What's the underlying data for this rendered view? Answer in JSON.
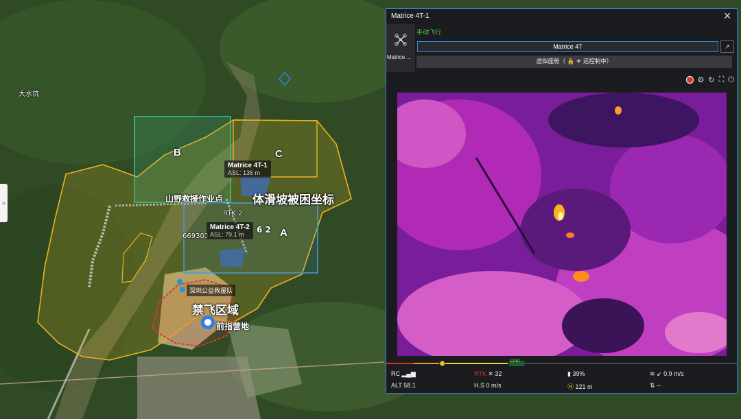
{
  "map": {
    "place_label": "大水坑",
    "zone_labels": {
      "a": "A",
      "b": "B",
      "c": "C"
    },
    "labels": {
      "rescue_area": "山野救援作业点",
      "landslide": "体滑坡被困坐标",
      "no_fly_zone": "禁飞区域",
      "forward_camp": "前指营地",
      "team": "深圳公益救援队",
      "coord_fragment": "669303",
      "rtk_fragment": "RTK 2",
      "num_fragment": "6 2"
    },
    "drones": [
      {
        "name": "Matrice 4T-1",
        "asl": "ASL: 136 m"
      },
      {
        "name": "Matrice 4T-2",
        "asl": "ASL: 79.1 m"
      }
    ],
    "collapse_handle": "«"
  },
  "panel": {
    "title": "Matrice 4T-1",
    "close": "✕",
    "thumb_caption": "Matrice ...",
    "flight_mode": "手动飞行",
    "device_name": "Matrice 4T",
    "dock_status": "虚拟座舱（ 🔒 ✈ 远控制中）",
    "timeline_marker": "12:51",
    "telemetry": {
      "rc_label": "RC",
      "rtk_label": "RTK",
      "rtk_value": "32",
      "battery": "39%",
      "wind": "↙ 0.9 m/s",
      "alt_label": "ALT",
      "alt_value": "58.1",
      "hs_label": "H.S",
      "hs_value": "0 m/s",
      "home_dist": "121 m",
      "vs_value": "--"
    },
    "colors": {
      "accent": "#3a7fd5",
      "mode": "#4ec95b",
      "rtk": "#e03030"
    }
  }
}
